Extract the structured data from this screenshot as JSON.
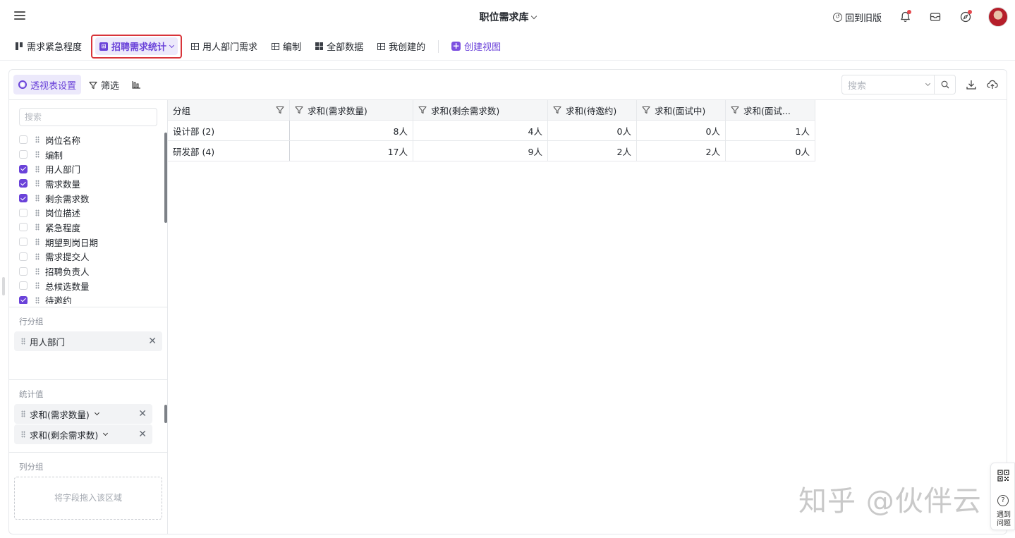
{
  "app": {
    "title": "职位需求库",
    "back_old": "回到旧版"
  },
  "tabs": [
    {
      "label": "需求紧急程度",
      "icon": "kanban-icon"
    },
    {
      "label": "招聘需求统计",
      "icon": "pivot-icon",
      "active": true
    },
    {
      "label": "用人部门需求",
      "icon": "table-icon"
    },
    {
      "label": "编制",
      "icon": "table-icon"
    },
    {
      "label": "全部数据",
      "icon": "grid-icon"
    },
    {
      "label": "我创建的",
      "icon": "table-icon"
    }
  ],
  "create_view": "创建视图",
  "toolbar": {
    "pivot_settings": "透视表设置",
    "filter": "筛选",
    "search_placeholder": "搜索"
  },
  "field_panel": {
    "search_placeholder": "搜索",
    "fields": [
      {
        "label": "岗位名称",
        "checked": false
      },
      {
        "label": "编制",
        "checked": false
      },
      {
        "label": "用人部门",
        "checked": true
      },
      {
        "label": "需求数量",
        "checked": true
      },
      {
        "label": "剩余需求数",
        "checked": true
      },
      {
        "label": "岗位描述",
        "checked": false
      },
      {
        "label": "紧急程度",
        "checked": false
      },
      {
        "label": "期望到岗日期",
        "checked": false
      },
      {
        "label": "需求提交人",
        "checked": false
      },
      {
        "label": "招聘负责人",
        "checked": false
      },
      {
        "label": "总候选数量",
        "checked": false
      },
      {
        "label": "待邀约",
        "checked": true
      }
    ],
    "row_group_title": "行分组",
    "row_group_chip": "用人部门",
    "values_title": "统计值",
    "value_chips": [
      "求和(需求数量)",
      "求和(剩余需求数)"
    ],
    "col_group_title": "列分组",
    "col_drop_hint": "将字段拖入该区域"
  },
  "table": {
    "headers": [
      "分组",
      "求和(需求数量)",
      "求和(剩余需求数)",
      "求和(待邀约)",
      "求和(面试中)",
      "求和(面试..."
    ],
    "rows": [
      {
        "group": "设计部 (2)",
        "cells": [
          "8人",
          "4人",
          "0人",
          "0人",
          "1人"
        ]
      },
      {
        "group": "研发部 (4)",
        "cells": [
          "17人",
          "9人",
          "2人",
          "2人",
          "0人"
        ]
      }
    ]
  },
  "float_tools": {
    "help_label": "遇到问题"
  },
  "watermark": "知乎 @伙伴云",
  "colors": {
    "accent": "#6a42d9",
    "highlight_border": "#d8343a",
    "notification_dot": "#e5484d"
  }
}
